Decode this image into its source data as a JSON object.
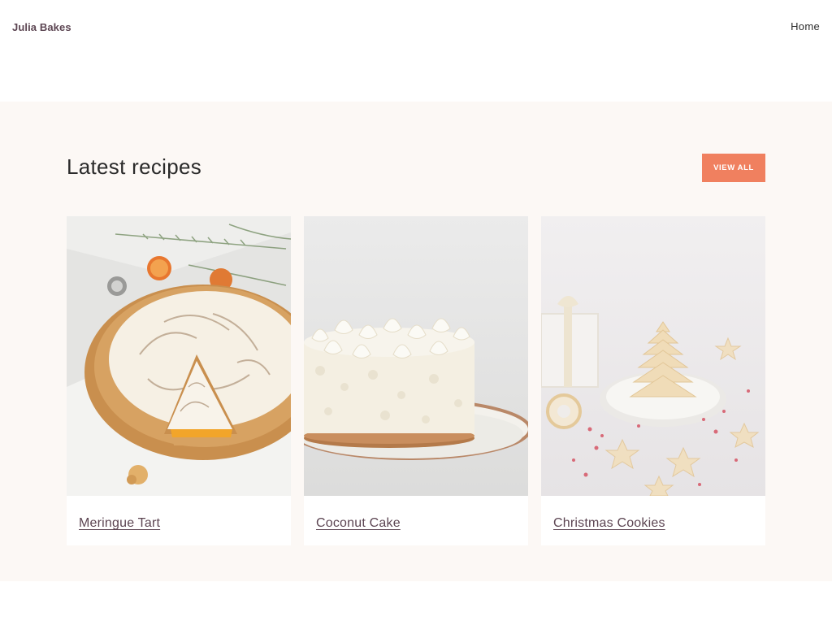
{
  "header": {
    "brand": "Julia Bakes",
    "nav": [
      {
        "label": "Home"
      }
    ]
  },
  "section": {
    "title": "Latest recipes",
    "view_all_label": "View all"
  },
  "recipes": [
    {
      "title": "Meringue Tart",
      "image": "meringue-tart-photo"
    },
    {
      "title": "Coconut Cake",
      "image": "coconut-cake-photo"
    },
    {
      "title": "Christmas Cookies",
      "image": "christmas-cookies-photo"
    }
  ],
  "colors": {
    "accent": "#f0805f",
    "brand_text": "#5c4552",
    "section_background": "#fcf8f5"
  }
}
